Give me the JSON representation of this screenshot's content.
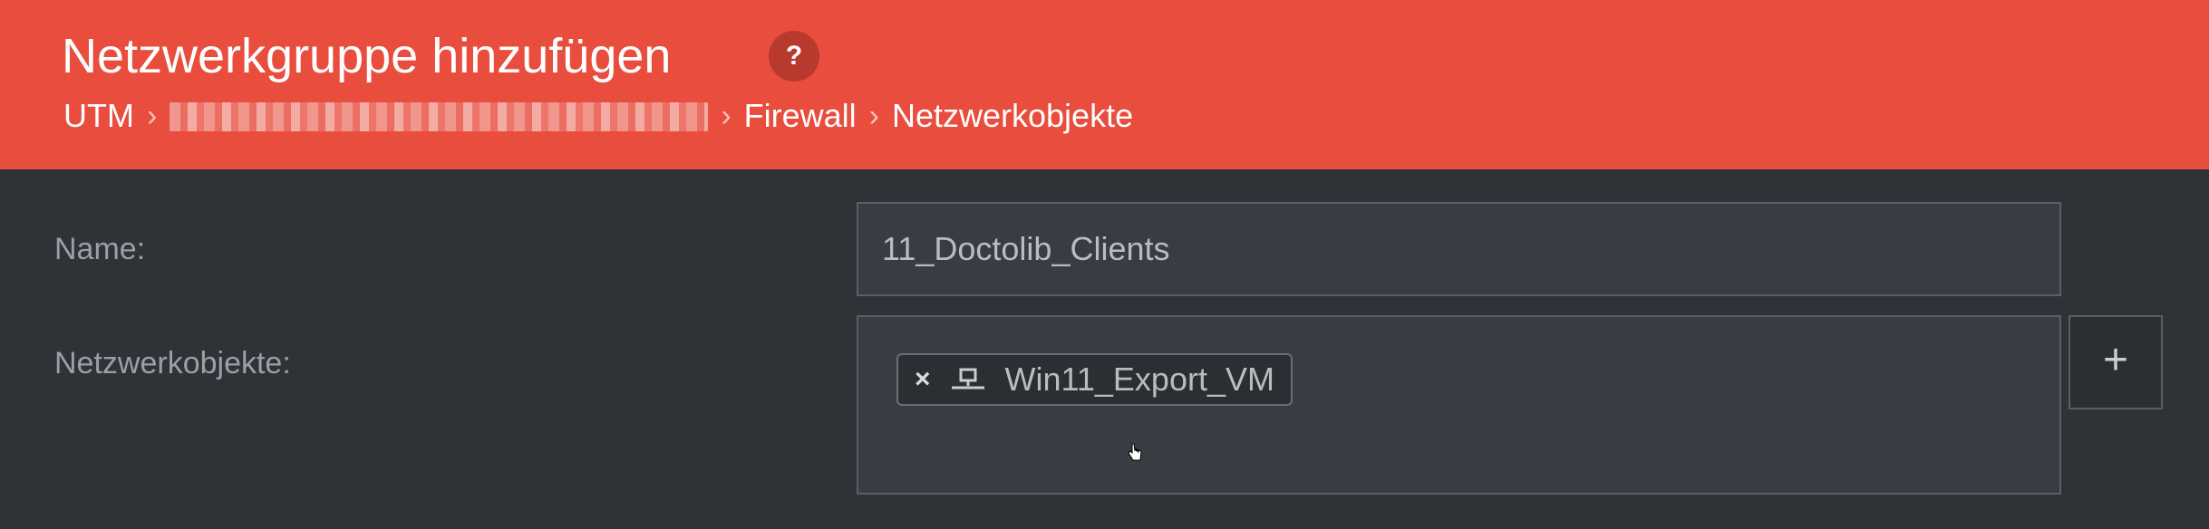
{
  "header": {
    "title": "Netzwerkgruppe hinzufügen",
    "help_label": "?",
    "help_icon": "question-circle-icon",
    "breadcrumb": [
      "UTM",
      "Firewall",
      "Netzwerkobjekte"
    ],
    "separator": "›"
  },
  "form": {
    "name_label": "Name:",
    "name_value": "11_Doctolib_Clients",
    "objects_label": "Netzwerkobjekte:",
    "objects": [
      {
        "remove_label": "×",
        "icon": "network-icon",
        "label": "Win11_Export_VM"
      }
    ],
    "add_label": "+"
  },
  "colors": {
    "header_bg": "#e84d3d",
    "content_bg": "#2f3236",
    "input_bg": "#383c43"
  }
}
